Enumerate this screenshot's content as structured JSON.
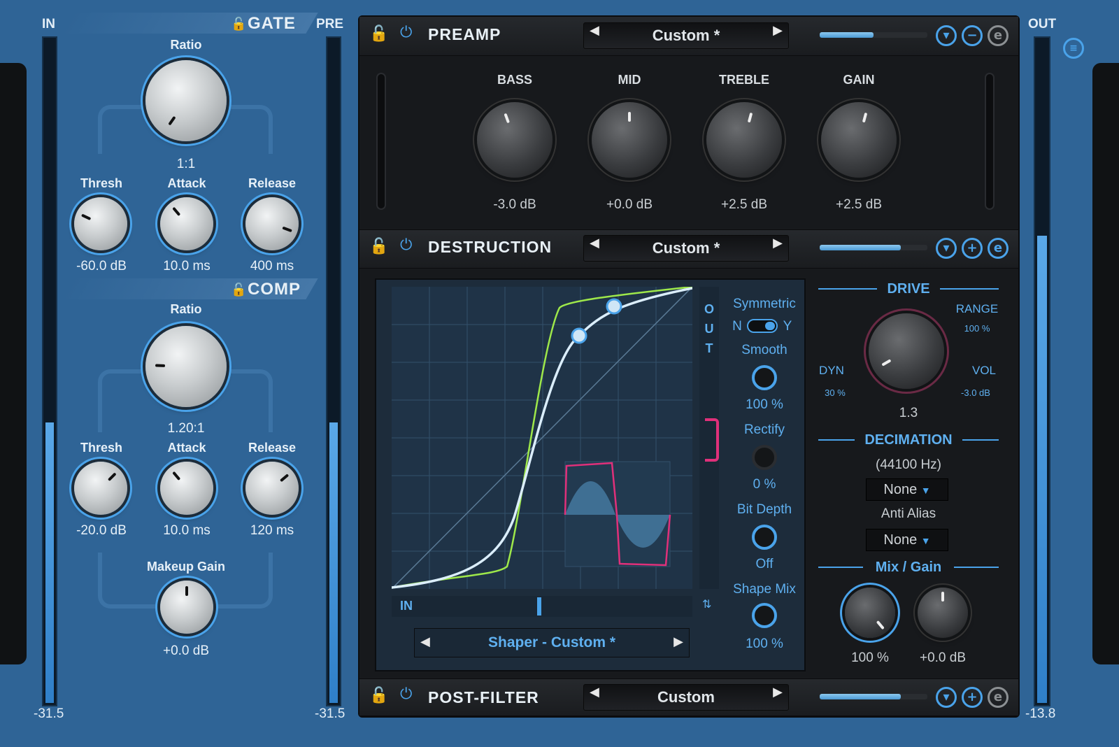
{
  "meters": {
    "in_label": "IN",
    "in_value": "-31.5",
    "pre_label": "PRE",
    "pre_value": "-31.5",
    "out_label": "OUT",
    "out_value": "-13.8",
    "in_level": 0.42,
    "pre_level": 0.42,
    "out_level": 0.7
  },
  "gate": {
    "title": "GATE",
    "ratio_label": "Ratio",
    "ratio_value": "1:1",
    "thresh_label": "Thresh",
    "thresh_value": "-60.0 dB",
    "attack_label": "Attack",
    "attack_value": "10.0 ms",
    "release_label": "Release",
    "release_value": "400 ms"
  },
  "comp": {
    "title": "COMP",
    "ratio_label": "Ratio",
    "ratio_value": "1.20:1",
    "thresh_label": "Thresh",
    "thresh_value": "-20.0 dB",
    "attack_label": "Attack",
    "attack_value": "10.0 ms",
    "release_label": "Release",
    "release_value": "120 ms",
    "makeup_label": "Makeup Gain",
    "makeup_value": "+0.0 dB"
  },
  "preamp": {
    "title": "PREAMP",
    "preset": "Custom *",
    "bass_label": "BASS",
    "bass_value": "-3.0 dB",
    "mid_label": "MID",
    "mid_value": "+0.0 dB",
    "treble_label": "TREBLE",
    "treble_value": "+2.5 dB",
    "gain_label": "GAIN",
    "gain_value": "+2.5 dB",
    "mix_level": 0.5
  },
  "destruction": {
    "title": "DESTRUCTION",
    "preset": "Custom *",
    "mix_level": 0.75,
    "graph": {
      "in_label": "IN",
      "out_label": "OUT",
      "shaper_preset": "Shaper - Custom *"
    },
    "symmetric_label": "Symmetric",
    "sym_n": "N",
    "sym_y": "Y",
    "smooth_label": "Smooth",
    "smooth_value": "100 %",
    "rectify_label": "Rectify",
    "rectify_value": "0 %",
    "bitdepth_label": "Bit Depth",
    "bitdepth_value": "Off",
    "shapemix_label": "Shape Mix",
    "shapemix_value": "100 %",
    "drive": {
      "title": "DRIVE",
      "range_label": "RANGE",
      "range_value": "100 %",
      "dyn_label": "DYN",
      "dyn_value": "30 %",
      "vol_label": "VOL",
      "vol_value": "-3.0 dB",
      "value": "1.3"
    },
    "decimation": {
      "title": "DECIMATION",
      "rate": "(44100 Hz)",
      "mode": "None",
      "antialias_label": "Anti Alias",
      "antialias_value": "None"
    },
    "mixgain": {
      "title_mix": "Mix",
      "title_sep": "/",
      "title_gain": "Gain",
      "mix_value": "100 %",
      "gain_value": "+0.0 dB"
    }
  },
  "postfilter": {
    "title": "POST-FILTER",
    "preset": "Custom",
    "mix_level": 0.75
  },
  "colors": {
    "accent": "#4aa3ea",
    "background": "#2f6496",
    "curve_green": "#9ee84a",
    "curve_white": "#dbeefc",
    "wave_pink": "#e0307a"
  }
}
